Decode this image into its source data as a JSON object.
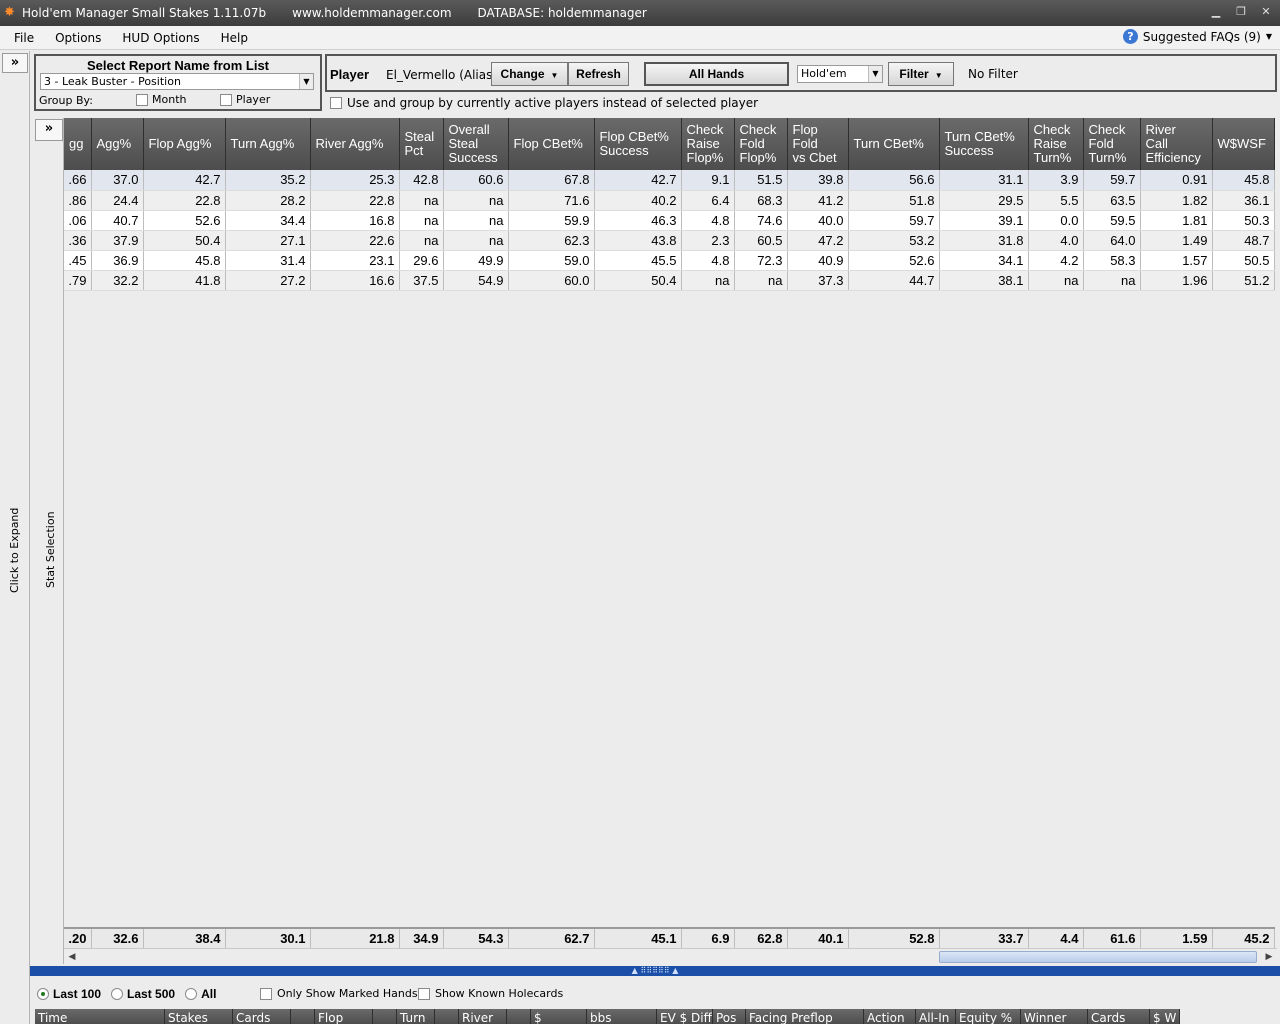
{
  "window": {
    "title": "Hold'em Manager Small Stakes 1.11.07b",
    "website": "www.holdemmanager.com",
    "database": "DATABASE: holdemmanager"
  },
  "menu": {
    "file": "File",
    "options": "Options",
    "hud_options": "HUD Options",
    "help": "Help",
    "faq": "Suggested FAQs (9)"
  },
  "left_strip": {
    "expand_label": "Click to Expand"
  },
  "stat_strip": {
    "label": "Stat Selection"
  },
  "report": {
    "heading": "Select Report Name from List",
    "selected": "3 - Leak Buster - Position",
    "group_by_label": "Group By:",
    "group_month": "Month",
    "group_player": "Player"
  },
  "player": {
    "label": "Player",
    "name": "El_Vermello (Alias)",
    "change": "Change",
    "refresh": "Refresh",
    "all_hands": "All Hands",
    "game_type": "Hold'em",
    "filter": "Filter",
    "filter_status": "No Filter",
    "active_players_label": "Use and group by currently active players instead of selected player"
  },
  "grid": {
    "columns": [
      "gg",
      "Agg%",
      "Flop Agg%",
      "Turn Agg%",
      "River Agg%",
      "Steal\nPct",
      "Overall\nSteal\nSuccess",
      "Flop CBet%",
      "Flop CBet%\nSuccess",
      "Check\nRaise\nFlop%",
      "Check\nFold\nFlop%",
      "Flop\nFold\nvs Cbet",
      "Turn CBet%",
      "Turn CBet%\nSuccess",
      "Check\nRaise\nTurn%",
      "Check\nFold\nTurn%",
      "River\nCall\nEfficiency",
      "W$WSF"
    ],
    "rows": [
      [
        ".66",
        "37.0",
        "42.7",
        "35.2",
        "25.3",
        "42.8",
        "60.6",
        "67.8",
        "42.7",
        "9.1",
        "51.5",
        "39.8",
        "56.6",
        "31.1",
        "3.9",
        "59.7",
        "0.91",
        "45.8"
      ],
      [
        ".86",
        "24.4",
        "22.8",
        "28.2",
        "22.8",
        "na",
        "na",
        "71.6",
        "40.2",
        "6.4",
        "68.3",
        "41.2",
        "51.8",
        "29.5",
        "5.5",
        "63.5",
        "1.82",
        "36.1"
      ],
      [
        ".06",
        "40.7",
        "52.6",
        "34.4",
        "16.8",
        "na",
        "na",
        "59.9",
        "46.3",
        "4.8",
        "74.6",
        "40.0",
        "59.7",
        "39.1",
        "0.0",
        "59.5",
        "1.81",
        "50.3"
      ],
      [
        ".36",
        "37.9",
        "50.4",
        "27.1",
        "22.6",
        "na",
        "na",
        "62.3",
        "43.8",
        "2.3",
        "60.5",
        "47.2",
        "53.2",
        "31.8",
        "4.0",
        "64.0",
        "1.49",
        "48.7"
      ],
      [
        ".45",
        "36.9",
        "45.8",
        "31.4",
        "23.1",
        "29.6",
        "49.9",
        "59.0",
        "45.5",
        "4.8",
        "72.3",
        "40.9",
        "52.6",
        "34.1",
        "4.2",
        "58.3",
        "1.57",
        "50.5"
      ],
      [
        ".79",
        "32.2",
        "41.8",
        "27.2",
        "16.6",
        "37.5",
        "54.9",
        "60.0",
        "50.4",
        "na",
        "na",
        "37.3",
        "44.7",
        "38.1",
        "na",
        "na",
        "1.96",
        "51.2"
      ]
    ],
    "totals": [
      ".20",
      "32.6",
      "38.4",
      "30.1",
      "21.8",
      "34.9",
      "54.3",
      "62.7",
      "45.1",
      "6.9",
      "62.8",
      "40.1",
      "52.8",
      "33.7",
      "4.4",
      "61.6",
      "1.59",
      "45.2"
    ]
  },
  "bottom": {
    "last100": "Last 100",
    "last500": "Last 500",
    "all": "All",
    "selected_range": "Last 100",
    "only_marked": "Only Show Marked Hands",
    "known_holecards": "Show Known Holecards",
    "hand_columns": [
      "Time",
      "Stakes",
      "Cards",
      "",
      "Flop",
      "",
      "Turn",
      "",
      "River",
      "",
      "$",
      "bbs",
      "EV $ Diff",
      "Pos",
      "Facing Preflop",
      "Action",
      "All-In",
      "Equity %",
      "Winner",
      "Cards",
      "$ W"
    ]
  }
}
